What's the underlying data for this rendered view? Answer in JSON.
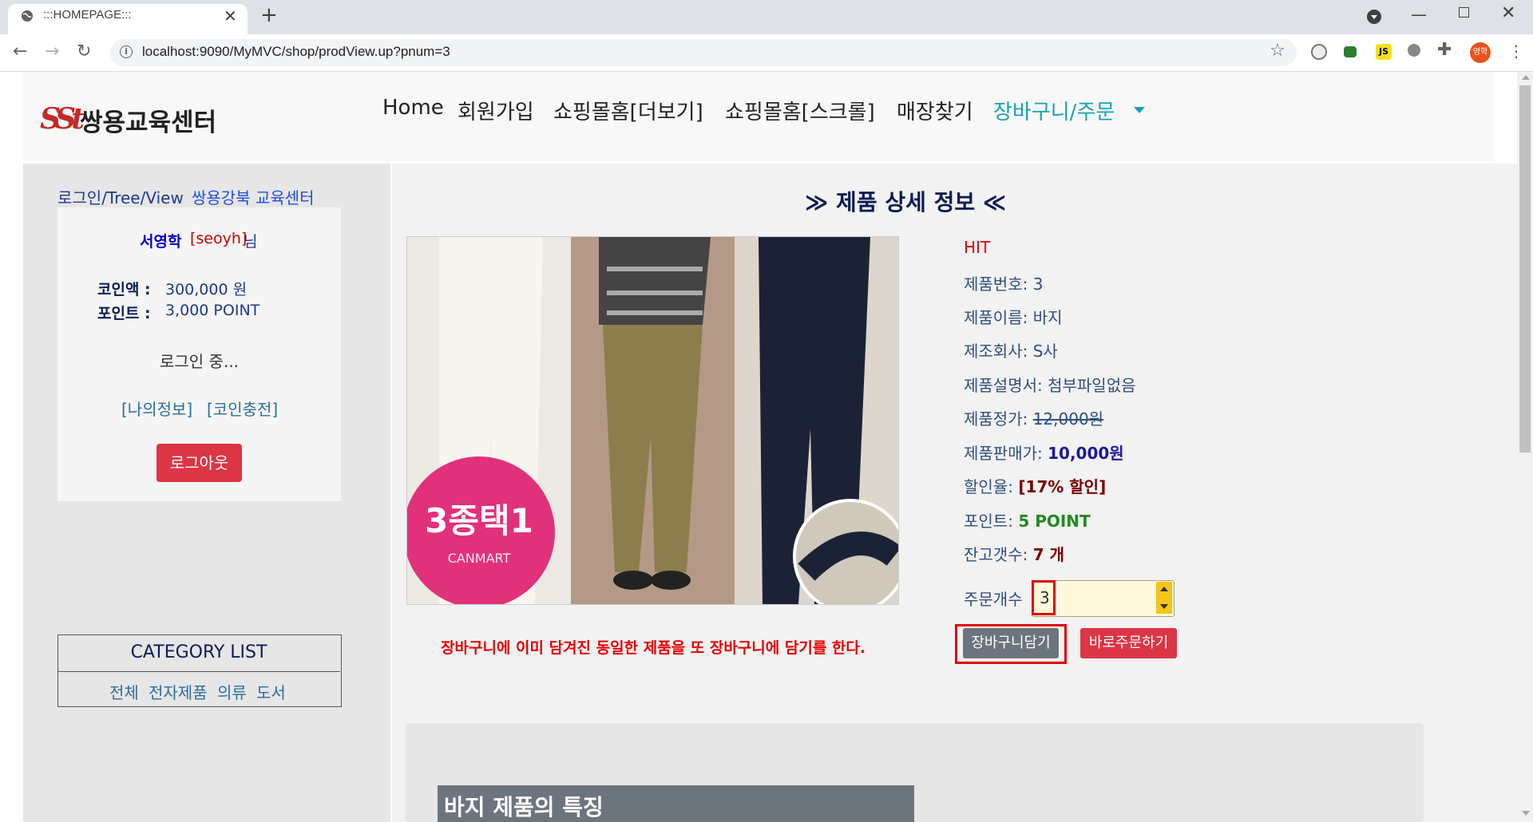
{
  "browser": {
    "tab_title": ":::HOMEPAGE:::",
    "url": "localhost:9090/MyMVC/shop/prodView.up?pnum=3",
    "profile_initial": "영학",
    "ext_js_label": "JS"
  },
  "header": {
    "logo_mark": "SSt",
    "logo_text": "쌍용교육센터",
    "menu": [
      "Home",
      "회원가입",
      "쇼핑몰홈[더보기]",
      "쇼핑몰홈[스크롤]",
      "매장찾기",
      "장바구니/주문"
    ]
  },
  "sidebar": {
    "title": "로그인/Tree/View",
    "title_link": "쌍용강북 교육센터",
    "user_name": "서영학",
    "user_id": "[seoyh]",
    "user_suffix": "님",
    "coin_label": "코인액 :",
    "coin_value": "300,000 원",
    "point_label": "포인트 :",
    "point_value": "3,000 POINT",
    "login_status": "로그인 중...",
    "my_info_link": "[나의정보]",
    "coin_charge_link": "[코인충전]",
    "logout_label": "로그아웃",
    "category_title": "CATEGORY LIST",
    "categories": [
      "전체",
      "전자제품",
      "의류",
      "도서"
    ]
  },
  "product": {
    "heading": "≫ 제품 상세 정보 ≪",
    "image_badge": "3종택1",
    "image_brand": "CANMART",
    "spec": "HIT",
    "num_label": "제품번호:",
    "num_value": "3",
    "name_label": "제품이름:",
    "name_value": "바지",
    "company_label": "제조회사:",
    "company_value": "S사",
    "manual_label": "제품설명서:",
    "manual_value": "첨부파일없음",
    "price_label": "제품정가:",
    "price_value": "12,000원",
    "sale_label": "제품판매가:",
    "sale_value": "10,000원",
    "discount_label": "할인율:",
    "discount_value": "[17% 할인]",
    "point_label": "포인트:",
    "point_value": "5 POINT",
    "stock_label": "잔고갯수:",
    "stock_value": "7 개",
    "qty_label": "주문개수",
    "qty_value": "3",
    "cart_button": "장바구니담기",
    "order_button": "바로주문하기",
    "warning": "장바구니에 이미 담겨진 동일한 제품을 또 장바구니에 담기를 한다.",
    "feature_title": "바지 제품의 특징"
  }
}
